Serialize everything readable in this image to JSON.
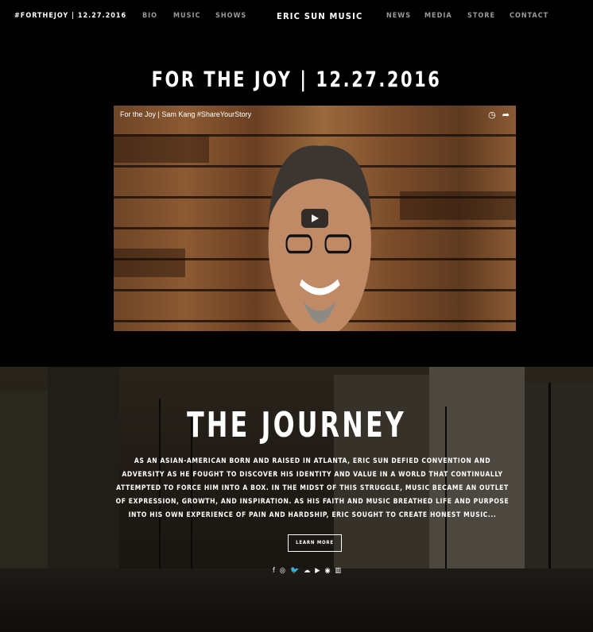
{
  "nav": {
    "left_tag": "#FORTHEJOY | 12.27.2016",
    "bio": "BIO",
    "music": "MUSIC",
    "shows": "SHOWS",
    "brand": "ERIC SUN MUSIC",
    "news": "NEWS",
    "media": "MEDIA",
    "store": "STORE",
    "contact": "CONTACT"
  },
  "hero": {
    "headline": "FOR THE JOY | 12.27.2016"
  },
  "video": {
    "title": "For the Joy | Sam Kang #ShareYourStory"
  },
  "journey": {
    "title": "THE JOURNEY",
    "text": "AS AN ASIAN-AMERICAN BORN AND RAISED IN ATLANTA, ERIC SUN DEFIED CONVENTION AND ADVERSITY AS HE FOUGHT TO DISCOVER HIS IDENTITY AND VALUE IN A WORLD THAT CONTINUALLY ATTEMPTED TO FORCE HIM INTO A BOX. IN THE MIDST OF THIS STRUGGLE, MUSIC BECAME AN OUTLET OF EXPRESSION, GROWTH, AND INSPIRATION. AS HIS FAITH AND MUSIC BREATHED LIFE AND PURPOSE INTO HIS OWN EXPERIENCE OF PAIN AND HARDSHIP, ERIC SOUGHT TO CREATE HONEST MUSIC...",
    "learn_more": "LEARN MORE"
  },
  "social": {
    "icons": [
      "facebook-icon",
      "instagram-icon",
      "twitter-icon",
      "soundcloud-icon",
      "youtube-icon",
      "spotify-icon",
      "bandsintown-icon"
    ],
    "glyphs": [
      "f",
      "◎",
      "🐦",
      "☁",
      "▶",
      "◉",
      "▥"
    ]
  }
}
